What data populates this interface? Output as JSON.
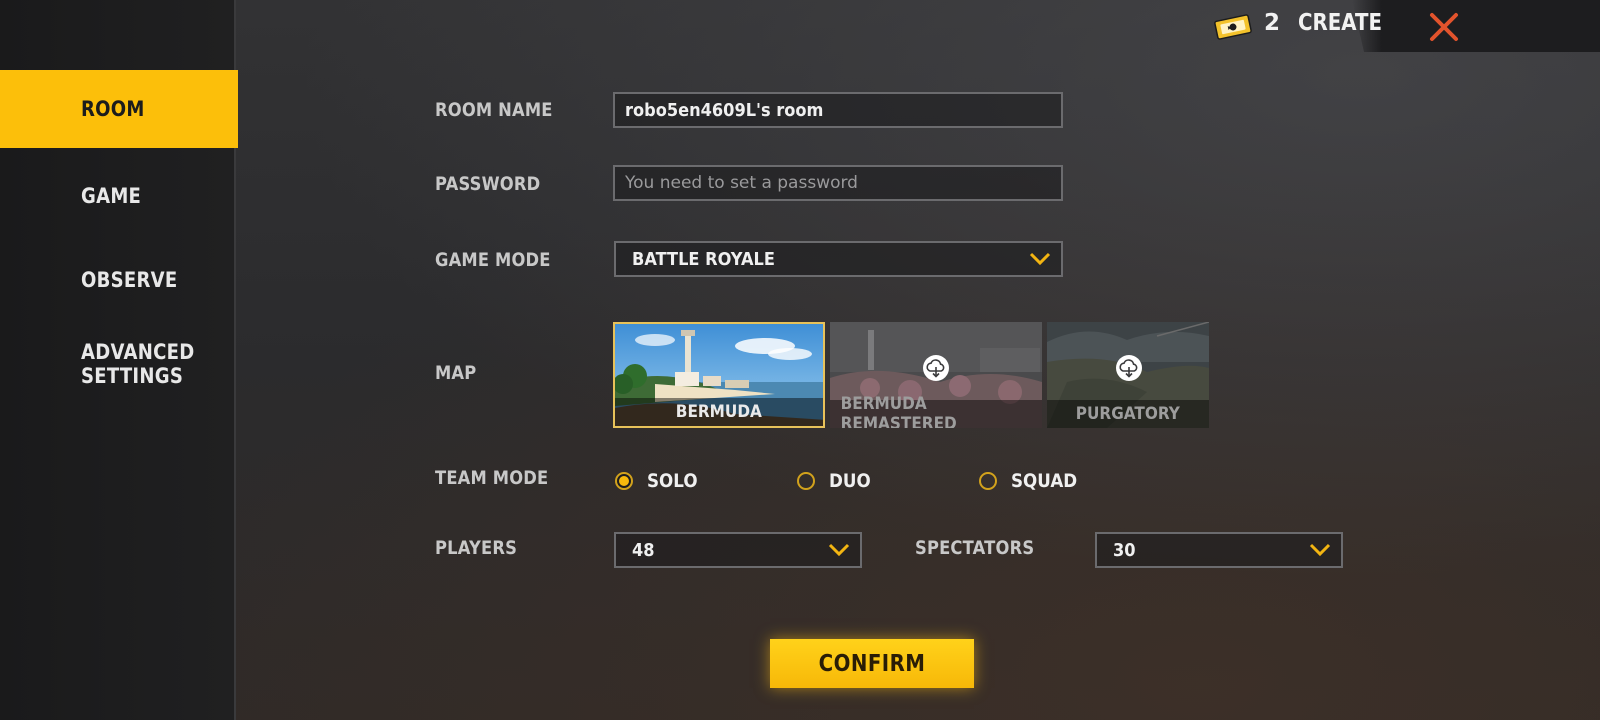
{
  "sidebar": {
    "items": [
      {
        "label": "ROOM",
        "active": true
      },
      {
        "label": "GAME",
        "active": false
      },
      {
        "label": "OBSERVE",
        "active": false
      },
      {
        "label": "ADVANCED\nSETTINGS",
        "active": false
      }
    ]
  },
  "topbar": {
    "ticket_icon": "room-card-icon",
    "ticket_count": "2",
    "create_label": "CREATE",
    "close_icon": "close-icon"
  },
  "form": {
    "room_name": {
      "label": "ROOM NAME",
      "value": "robo5en4609L's room"
    },
    "password": {
      "label": "PASSWORD",
      "placeholder": "You need to set a password",
      "value": ""
    },
    "game_mode": {
      "label": "GAME MODE",
      "value": "BATTLE ROYALE"
    },
    "map": {
      "label": "MAP",
      "options": [
        {
          "name": "BERMUDA",
          "selected": true,
          "downloaded": true
        },
        {
          "name": "BERMUDA REMASTERED",
          "selected": false,
          "downloaded": false
        },
        {
          "name": "PURGATORY",
          "selected": false,
          "downloaded": false
        }
      ]
    },
    "team_mode": {
      "label": "TEAM MODE",
      "options": [
        {
          "label": "SOLO",
          "selected": true
        },
        {
          "label": "DUO",
          "selected": false
        },
        {
          "label": "SQUAD",
          "selected": false
        }
      ]
    },
    "players": {
      "label": "PLAYERS",
      "value": "48"
    },
    "spectators": {
      "label": "SPECTATORS",
      "value": "30"
    }
  },
  "confirm_label": "CONFIRM",
  "colors": {
    "accent": "#fcbf0a",
    "sidebar_bg": "#1d1d1e",
    "field_border": "#6b6b6e",
    "close": "#e2532c"
  }
}
